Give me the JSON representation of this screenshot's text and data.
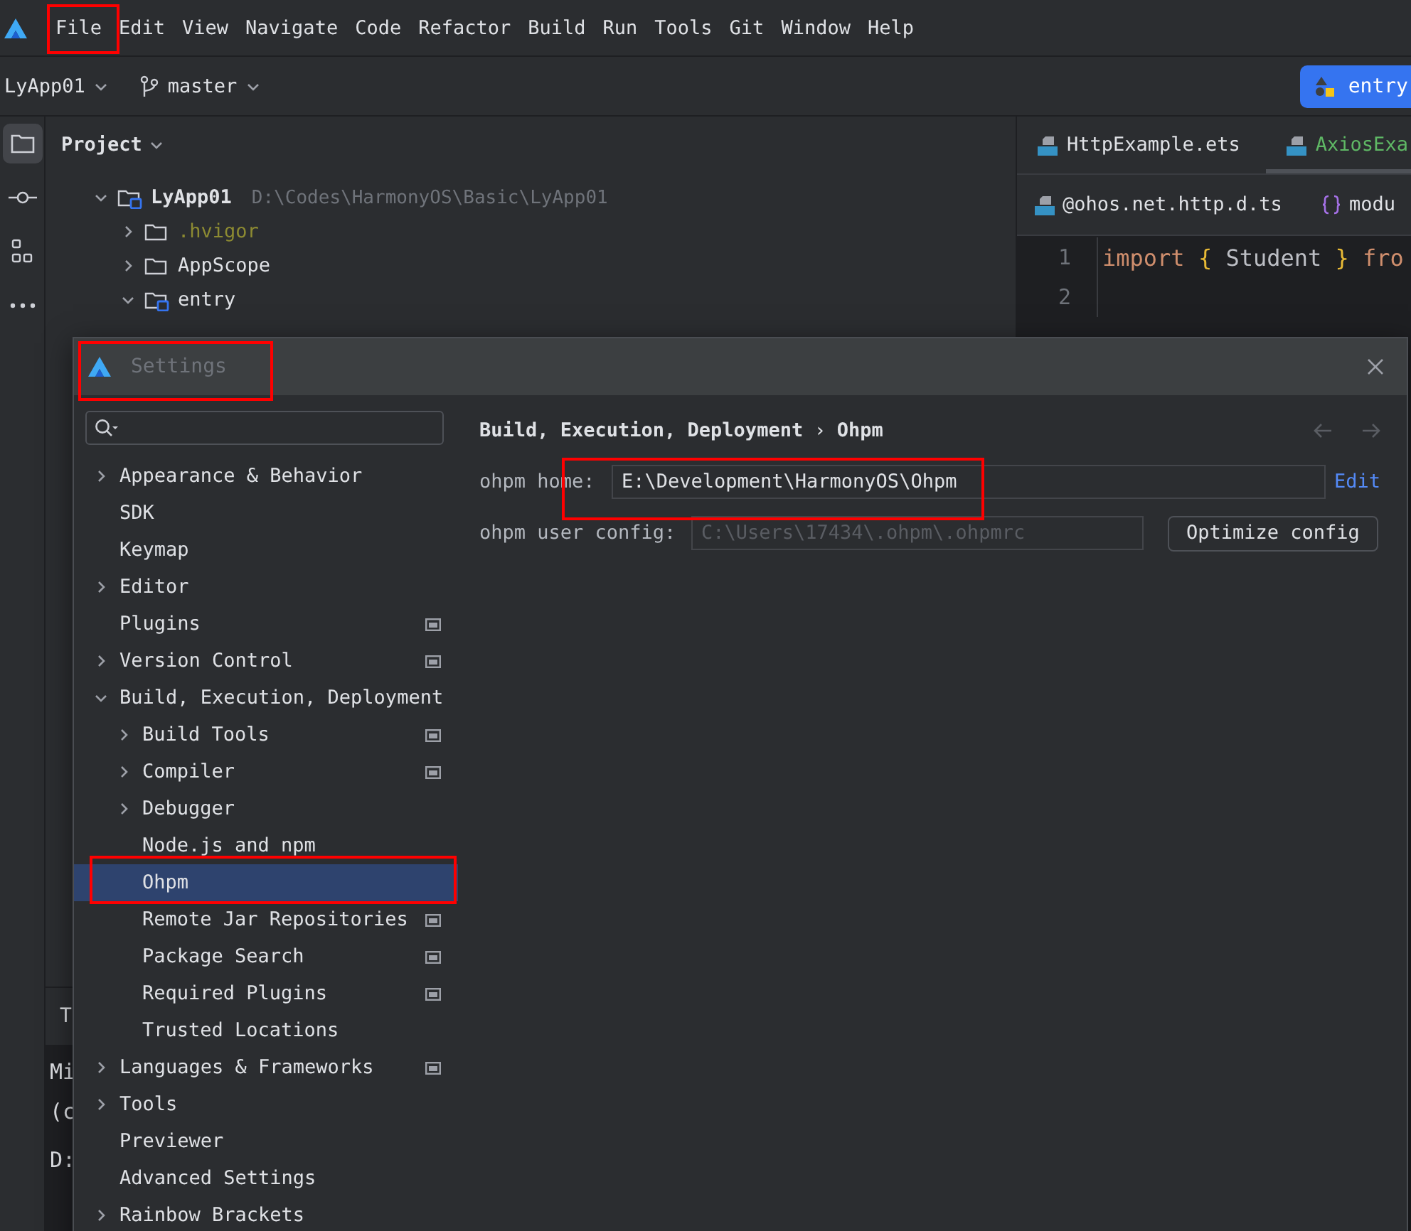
{
  "menu": [
    {
      "label": "File",
      "annotated": true
    },
    {
      "label": "Edit"
    },
    {
      "label": "View"
    },
    {
      "label": "Navigate"
    },
    {
      "label": "Code"
    },
    {
      "label": "Refactor"
    },
    {
      "label": "Build"
    },
    {
      "label": "Run"
    },
    {
      "label": "Tools"
    },
    {
      "label": "Git"
    },
    {
      "label": "Window"
    },
    {
      "label": "Help"
    }
  ],
  "toolbar": {
    "project": "LyApp01",
    "branch": "master",
    "run_config": "entry"
  },
  "tool_strip": [
    {
      "kind": "folder",
      "selected": true
    },
    {
      "kind": "commit",
      "selected": false
    },
    {
      "kind": "structure",
      "selected": false
    },
    {
      "kind": "more",
      "selected": false
    }
  ],
  "project_panel": {
    "title": "Project",
    "tree": [
      {
        "label": "LyApp01",
        "path": "D:\\Codes\\HarmonyOS\\Basic\\LyApp01",
        "module": true,
        "ignored": false,
        "excluded": false,
        "expanded": true,
        "children": [
          {
            "label": ".hvigor",
            "module": false,
            "ignored": true,
            "excluded": false,
            "expanded": false
          },
          {
            "label": "AppScope",
            "module": false,
            "ignored": false,
            "excluded": false,
            "expanded": false
          },
          {
            "label": "entry",
            "module": true,
            "ignored": false,
            "excluded": false,
            "expanded": true
          }
        ]
      }
    ]
  },
  "bottom_panel": {
    "tab": "T",
    "lines": [
      "Mi",
      "(c",
      "D:"
    ]
  },
  "editor": {
    "tabs": [
      {
        "label": "HttpExample.ets",
        "selected": false
      },
      {
        "label": "AxiosExa",
        "selected": true
      }
    ],
    "breadcrumbs": [
      {
        "label": "@ohos.net.http.d.ts",
        "kind": "ts"
      },
      {
        "label": "modu",
        "kind": "braces"
      }
    ],
    "lines": [
      {
        "number": "1",
        "tokens": [
          {
            "text": "import ",
            "kind": "keyword"
          },
          {
            "text": "{ ",
            "kind": "brace"
          },
          {
            "text": "Student ",
            "kind": "plain"
          },
          {
            "text": "} ",
            "kind": "brace"
          },
          {
            "text": "fro",
            "kind": "keyword"
          }
        ]
      },
      {
        "number": "2"
      }
    ]
  },
  "settings": {
    "title": "Settings",
    "title_annotated": true,
    "tree": [
      {
        "label": "Appearance & Behavior",
        "expanded": false,
        "selected": false,
        "project_level": false
      },
      {
        "label": "SDK",
        "selected": false,
        "project_level": false
      },
      {
        "label": "Keymap",
        "selected": false,
        "project_level": false
      },
      {
        "label": "Editor",
        "expanded": false,
        "selected": false,
        "project_level": false
      },
      {
        "label": "Plugins",
        "selected": false,
        "project_level": true
      },
      {
        "label": "Version Control",
        "expanded": false,
        "selected": false,
        "project_level": true
      },
      {
        "label": "Build, Execution, Deployment",
        "expanded": true,
        "selected": false,
        "project_level": false,
        "children": [
          {
            "label": "Build Tools",
            "expanded": false,
            "selected": false,
            "project_level": true
          },
          {
            "label": "Compiler",
            "expanded": false,
            "selected": false,
            "project_level": true
          },
          {
            "label": "Debugger",
            "expanded": false,
            "selected": false,
            "project_level": false
          },
          {
            "label": "Node.js and npm",
            "selected": false,
            "project_level": false
          },
          {
            "label": "Ohpm",
            "selected": true,
            "project_level": false,
            "annotated": true
          },
          {
            "label": "Remote Jar Repositories",
            "selected": false,
            "project_level": true
          },
          {
            "label": "Package Search",
            "selected": false,
            "project_level": true
          },
          {
            "label": "Required Plugins",
            "selected": false,
            "project_level": true
          },
          {
            "label": "Trusted Locations",
            "selected": false,
            "project_level": false
          }
        ]
      },
      {
        "label": "Languages & Frameworks",
        "expanded": false,
        "selected": false,
        "project_level": true
      },
      {
        "label": "Tools",
        "expanded": false,
        "selected": false,
        "project_level": false
      },
      {
        "label": "Previewer",
        "selected": false,
        "project_level": false
      },
      {
        "label": "Advanced Settings",
        "selected": false,
        "project_level": false
      },
      {
        "label": "Rainbow Brackets",
        "expanded": false,
        "selected": false,
        "project_level": false
      }
    ],
    "breadcrumb": [
      "Build, Execution, Deployment",
      "Ohpm"
    ],
    "breadcrumb_separator": "›",
    "ohpm_home": {
      "label": "ohpm home:",
      "value": "E:\\Development\\HarmonyOS\\Ohpm",
      "link": "Edit",
      "annotated": true
    },
    "user_config": {
      "label": "ohpm user config:",
      "value": "C:\\Users\\17434\\.ohpm\\.ohpmrc",
      "disabled": true,
      "button": "Optimize config"
    }
  }
}
